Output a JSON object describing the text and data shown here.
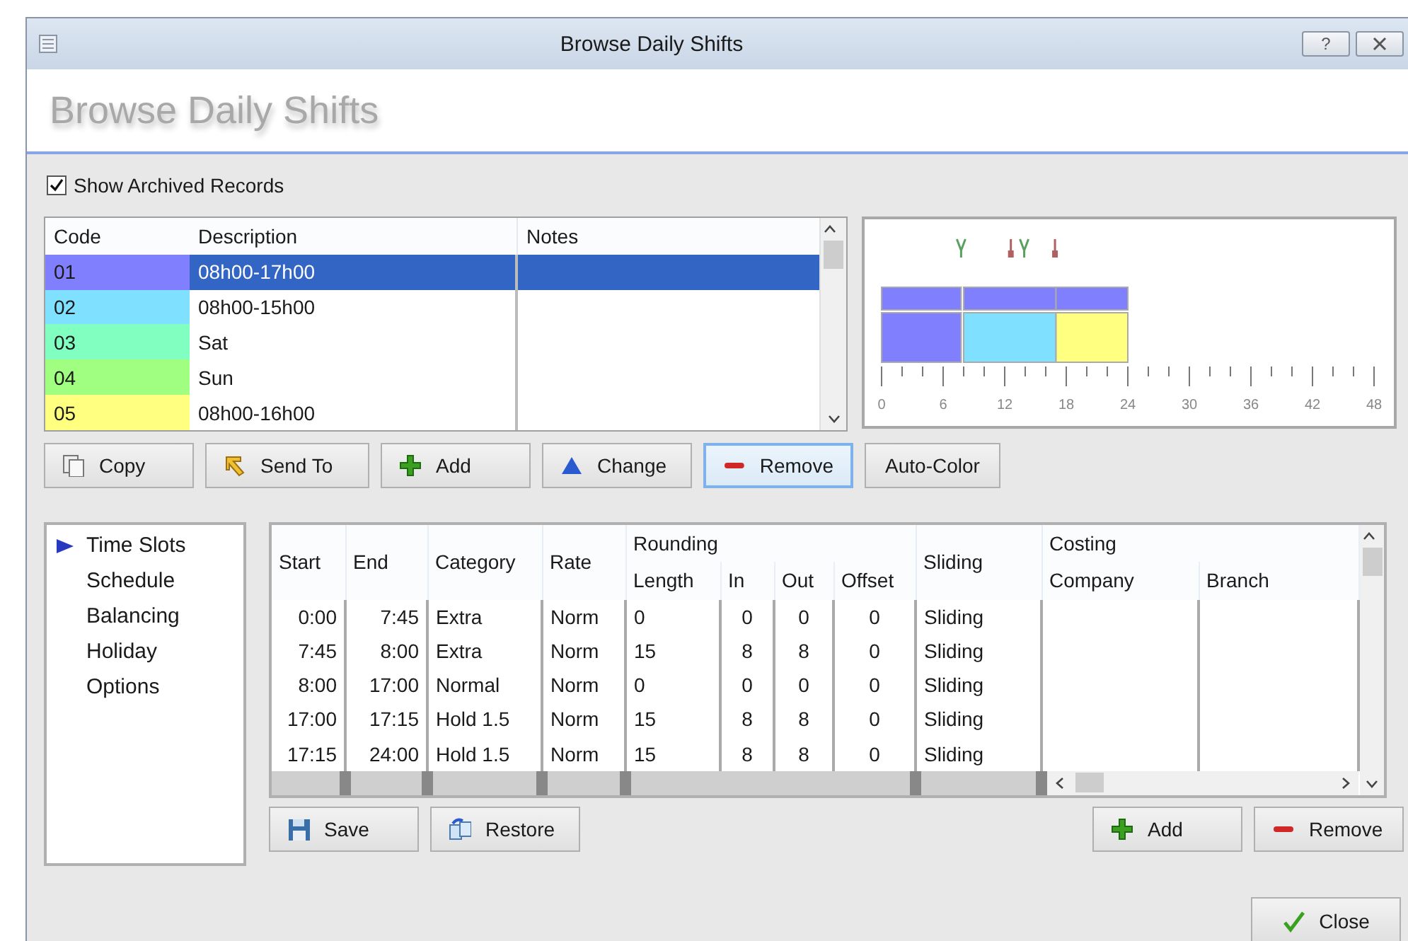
{
  "window": {
    "title": "Browse Daily Shifts",
    "help_glyph": "?"
  },
  "header": {
    "title": "Browse Daily Shifts"
  },
  "show_archived": {
    "label": "Show Archived Records",
    "checked": true
  },
  "shifts": {
    "columns": [
      "Code",
      "Description",
      "Notes"
    ],
    "rows": [
      {
        "code": "01",
        "description": "08h00-17h00",
        "color": "#8080ff",
        "selected": true
      },
      {
        "code": "02",
        "description": "08h00-15h00",
        "color": "#80e0ff",
        "selected": false
      },
      {
        "code": "03",
        "description": "Sat",
        "color": "#80ffc0",
        "selected": false
      },
      {
        "code": "04",
        "description": "Sun",
        "color": "#a0ff80",
        "selected": false
      },
      {
        "code": "05",
        "description": "08h00-16h00",
        "color": "#ffff80",
        "selected": false
      }
    ]
  },
  "timeline": {
    "ruler_labels": [
      "0",
      "6",
      "12",
      "18",
      "24",
      "30",
      "36",
      "42",
      "48"
    ]
  },
  "shift_buttons": [
    {
      "label": "Copy",
      "kind": "copy",
      "focused": false
    },
    {
      "label": "Send To",
      "kind": "send",
      "focused": false
    },
    {
      "label": "Add",
      "kind": "add",
      "focused": false
    },
    {
      "label": "Change",
      "kind": "change",
      "focused": false
    },
    {
      "label": "Remove",
      "kind": "remove",
      "focused": true
    },
    {
      "label": "Auto-Color",
      "kind": "plain",
      "focused": false
    }
  ],
  "sections": [
    {
      "label": "Time Slots",
      "selected": true
    },
    {
      "label": "Schedule",
      "selected": false
    },
    {
      "label": "Balancing",
      "selected": false
    },
    {
      "label": "Holiday",
      "selected": false
    },
    {
      "label": "Options",
      "selected": false
    }
  ],
  "slots": {
    "columns": [
      {
        "label": "Start"
      },
      {
        "label": "End"
      },
      {
        "label": "Category"
      },
      {
        "label": "Rate"
      },
      {
        "label": "Rounding",
        "colspan": 4,
        "children": [
          {
            "label": "Length"
          },
          {
            "label": "In"
          },
          {
            "label": "Out"
          },
          {
            "label": "Offset"
          }
        ]
      },
      {
        "label": "Sliding"
      },
      {
        "label": "Costing",
        "colspan": 2,
        "children": [
          {
            "label": "Company"
          },
          {
            "label": "Branch"
          }
        ]
      }
    ],
    "rows": [
      [
        "0:00",
        "7:45",
        "Extra",
        "Norm",
        "0",
        "0",
        "0",
        "0",
        "Sliding"
      ],
      [
        "7:45",
        "8:00",
        "Extra",
        "Norm",
        "15",
        "8",
        "8",
        "0",
        "Sliding"
      ],
      [
        "8:00",
        "17:00",
        "Normal",
        "Norm",
        "0",
        "0",
        "0",
        "0",
        "Sliding"
      ],
      [
        "17:00",
        "17:15",
        "Hold 1.5",
        "Norm",
        "15",
        "8",
        "8",
        "0",
        "Sliding"
      ],
      [
        "17:15",
        "24:00",
        "Hold 1.5",
        "Norm",
        "15",
        "8",
        "8",
        "0",
        "Sliding"
      ]
    ]
  },
  "slot_buttons_left": [
    {
      "label": "Save",
      "kind": "save"
    },
    {
      "label": "Restore",
      "kind": "restore"
    }
  ],
  "slot_buttons_right": [
    {
      "label": "Add",
      "kind": "add"
    },
    {
      "label": "Remove",
      "kind": "remove"
    }
  ],
  "close_button": {
    "label": "Close",
    "kind": "check"
  }
}
